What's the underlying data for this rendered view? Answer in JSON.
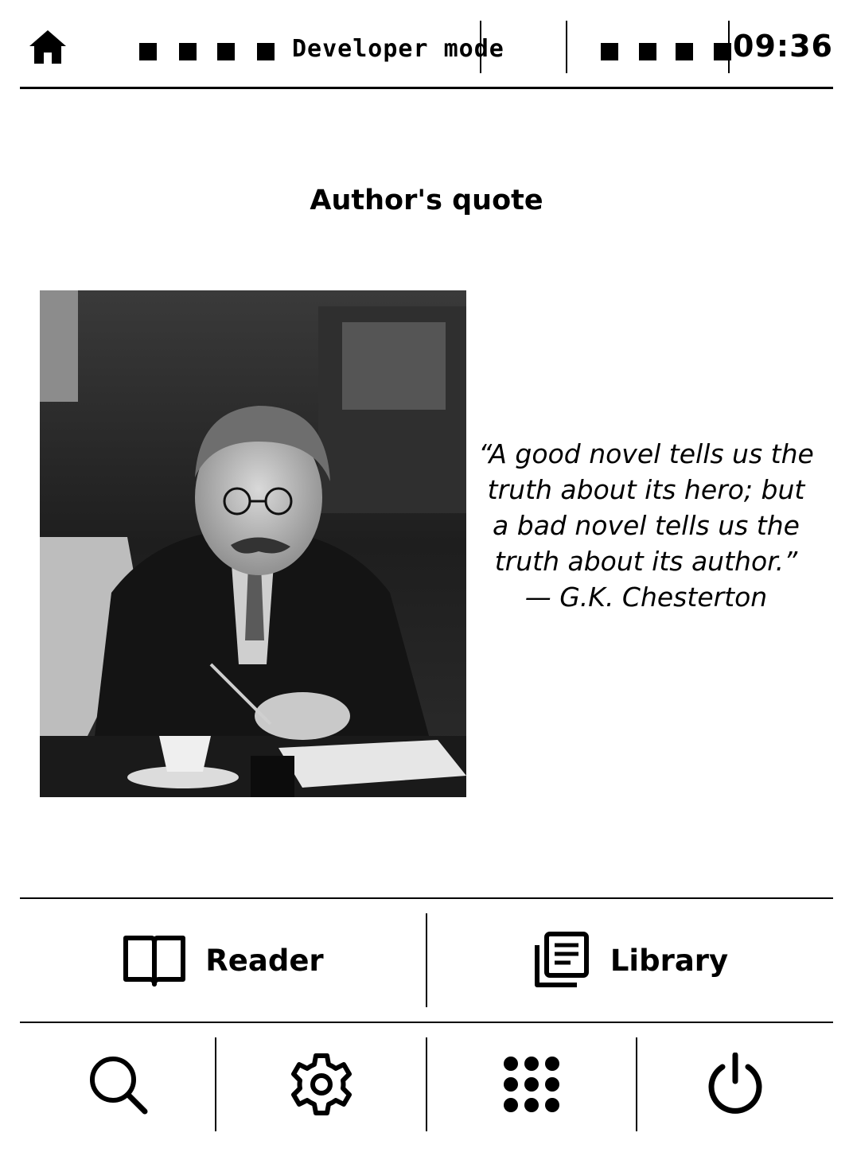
{
  "status_bar": {
    "home_icon": "home-icon",
    "developer_mode_label": "Developer mode",
    "clock": "09:36"
  },
  "page_title": "Author's quote",
  "portrait": {
    "subject": "author-portrait-photo"
  },
  "quote": {
    "text": "“A good novel tells us the truth about its hero; but a bad novel tells us the truth about its author.”",
    "attribution": "— G.K. Chesterton"
  },
  "nav": {
    "reader": {
      "label": "Reader",
      "icon": "book-open-icon"
    },
    "library": {
      "label": "Library",
      "icon": "library-icon"
    }
  },
  "toolbar": [
    {
      "icon": "search-icon"
    },
    {
      "icon": "gear-icon"
    },
    {
      "icon": "apps-grid-icon"
    },
    {
      "icon": "power-icon"
    }
  ],
  "colors": {
    "foreground": "#000000",
    "background": "#ffffff"
  }
}
